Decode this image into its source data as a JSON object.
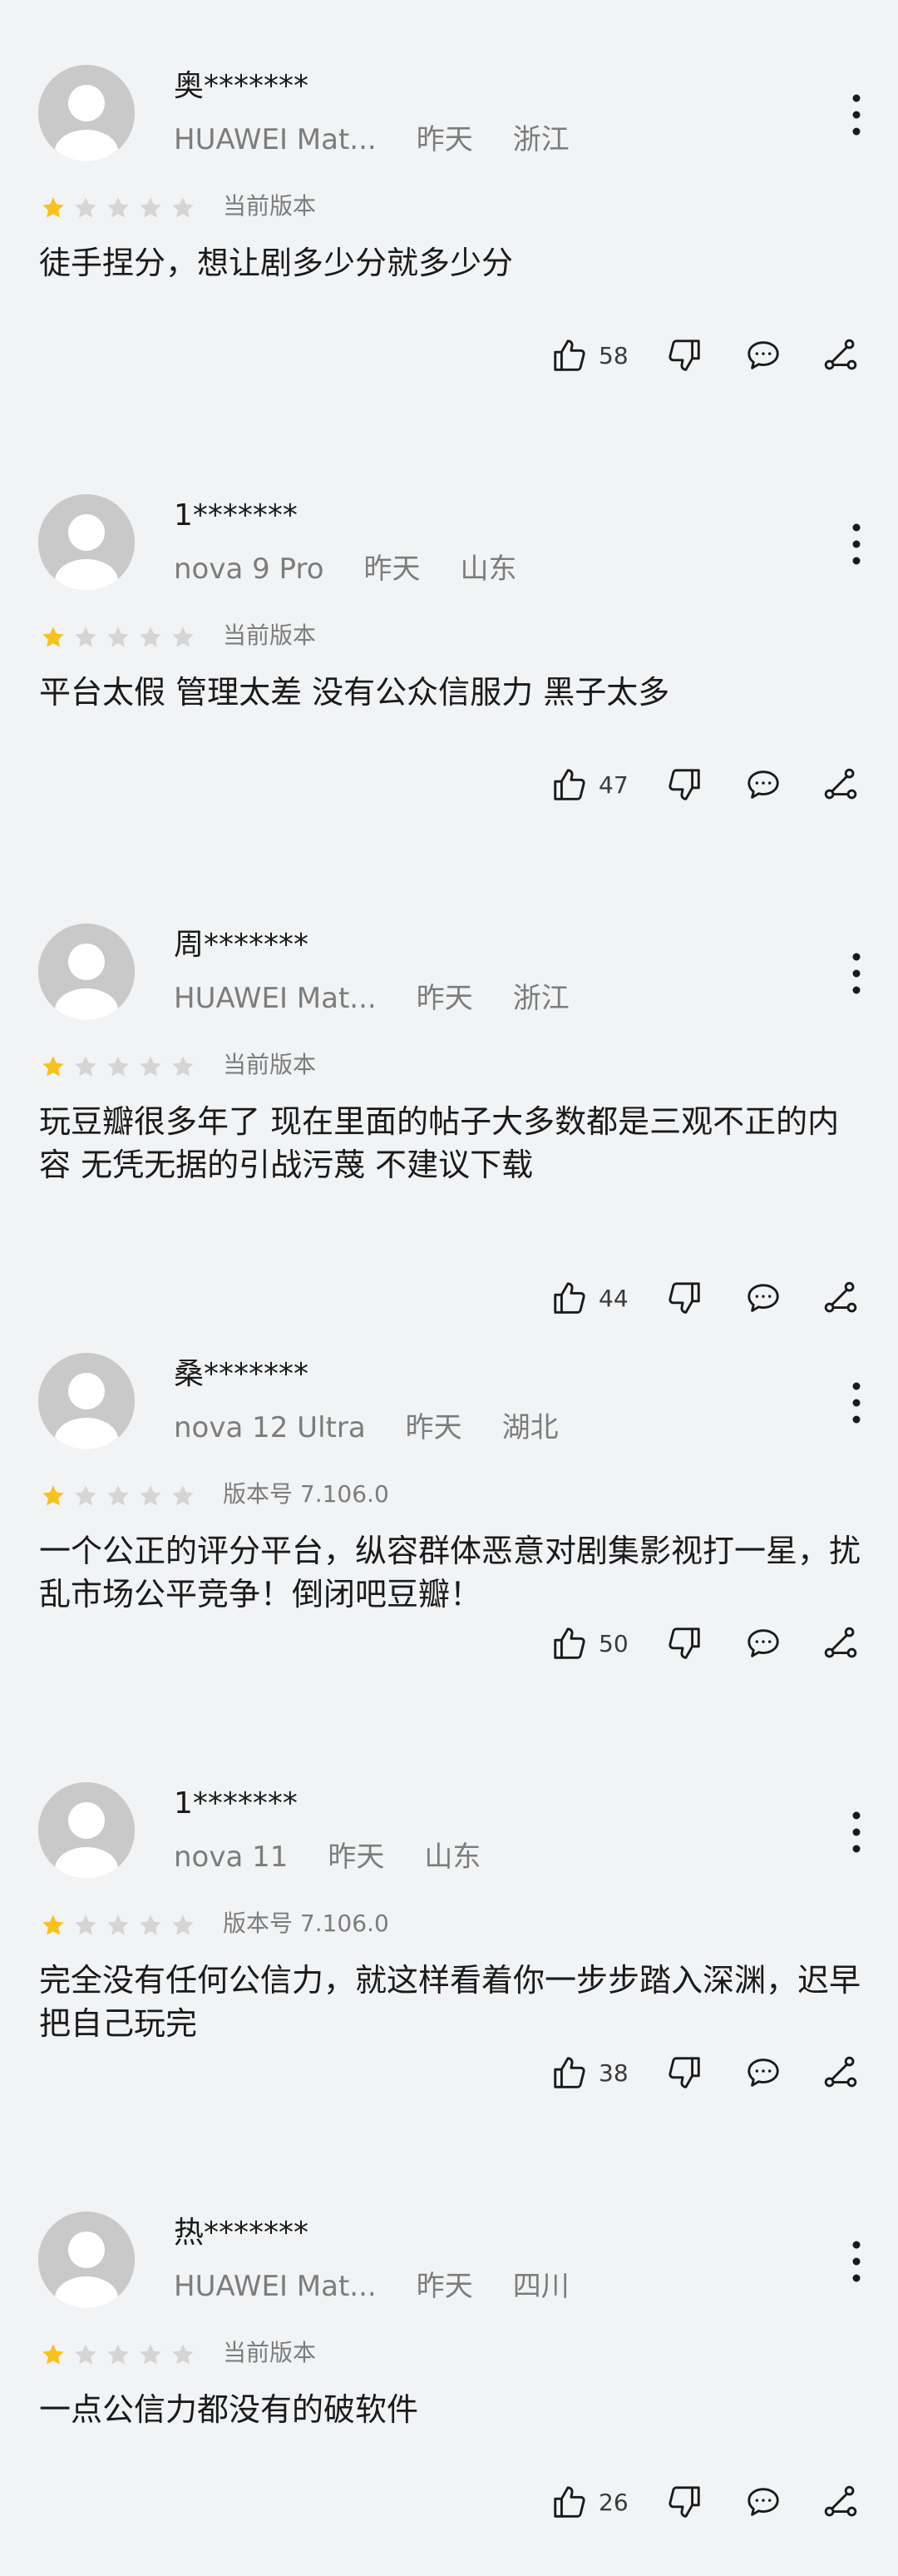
{
  "colors": {
    "background": "#f1f3f5",
    "star_active": "#f8c21c",
    "star_inactive": "#d5d5d5",
    "avatar_bg": "#c9c9c9",
    "secondary_text": "#7c7c7c"
  },
  "rating_scale": 5,
  "reviews": [
    {
      "username": "奥*******",
      "device": "HUAWEI Mat...",
      "time": "昨天",
      "region": "浙江",
      "rating": 1,
      "version": "当前版本",
      "content": "徒手捏分，想让剧多少分就多少分",
      "likes": "58"
    },
    {
      "username": "1*******",
      "device": "nova 9 Pro",
      "time": "昨天",
      "region": "山东",
      "rating": 1,
      "version": "当前版本",
      "content": "平台太假 管理太差 没有公众信服力 黑子太多",
      "likes": "47"
    },
    {
      "username": "周*******",
      "device": "HUAWEI Mat...",
      "time": "昨天",
      "region": "浙江",
      "rating": 1,
      "version": "当前版本",
      "content": "玩豆瓣很多年了 现在里面的帖子大多数都是三观不正的内容 无凭无据的引战污蔑 不建议下载",
      "likes": "44"
    },
    {
      "username": "桑*******",
      "device": "nova 12 Ultra",
      "time": "昨天",
      "region": "湖北",
      "rating": 1,
      "version": "版本号 7.106.0",
      "content": "一个公正的评分平台，纵容群体恶意对剧集影视打一星，扰乱市场公平竞争！倒闭吧豆瓣！",
      "likes": "50"
    },
    {
      "username": "1*******",
      "device": "nova 11",
      "time": "昨天",
      "region": "山东",
      "rating": 1,
      "version": "版本号 7.106.0",
      "content": "完全没有任何公信力，就这样看着你一步步踏入深渊，迟早把自己玩完",
      "likes": "38"
    },
    {
      "username": "热*******",
      "device": "HUAWEI Mat...",
      "time": "昨天",
      "region": "四川",
      "rating": 1,
      "version": "当前版本",
      "content": "一点公信力都没有的破软件",
      "likes": "26"
    }
  ]
}
